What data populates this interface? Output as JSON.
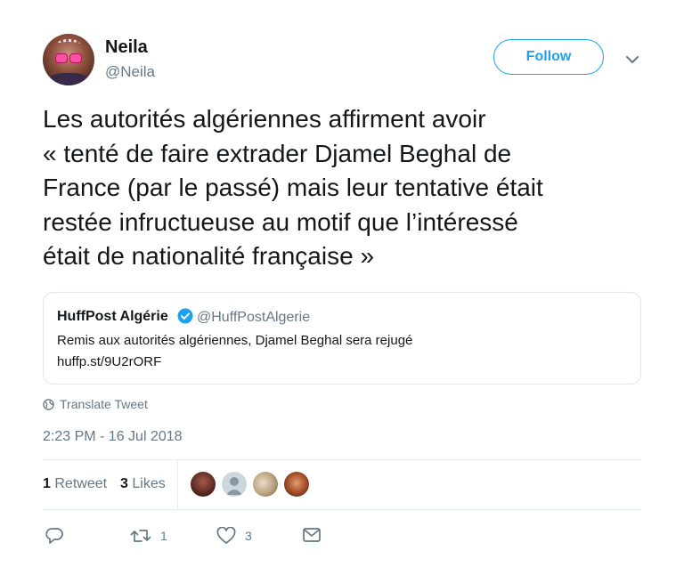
{
  "author": {
    "name": "Neila",
    "handle": "@Neila"
  },
  "follow_label": "Follow",
  "tweet": {
    "lines": [
      "Les autorités algériennes affirment avoir",
      "« tenté de faire extrader Djamel Beghal de",
      "France (par le passé) mais leur tentative était",
      "restée infructueuse au motif que l’intéressé",
      "était de nationalité française »"
    ]
  },
  "quoted": {
    "name": "HuffPost Algérie",
    "handle": "@HuffPostAlgerie",
    "text": "Remis aux autorités algériennes, Djamel Beghal sera rejugé",
    "link": "huffp.st/9U2rORF"
  },
  "translate_label": "Translate Tweet",
  "timestamp": "2:23 PM - 16 Jul 2018",
  "stats": {
    "retweets": "1",
    "retweets_label": "Retweet",
    "likes": "3",
    "likes_label": "Likes"
  },
  "actions": {
    "retweet_count": "1",
    "like_count": "3"
  },
  "colors": {
    "accent": "#1da1f2",
    "muted": "#657786",
    "text": "#14171a",
    "border": "#e1e8ed"
  },
  "icons": [
    "chevron-down-icon",
    "verified-badge-icon",
    "globe-icon",
    "reply-icon",
    "retweet-icon",
    "heart-icon",
    "envelope-icon"
  ]
}
